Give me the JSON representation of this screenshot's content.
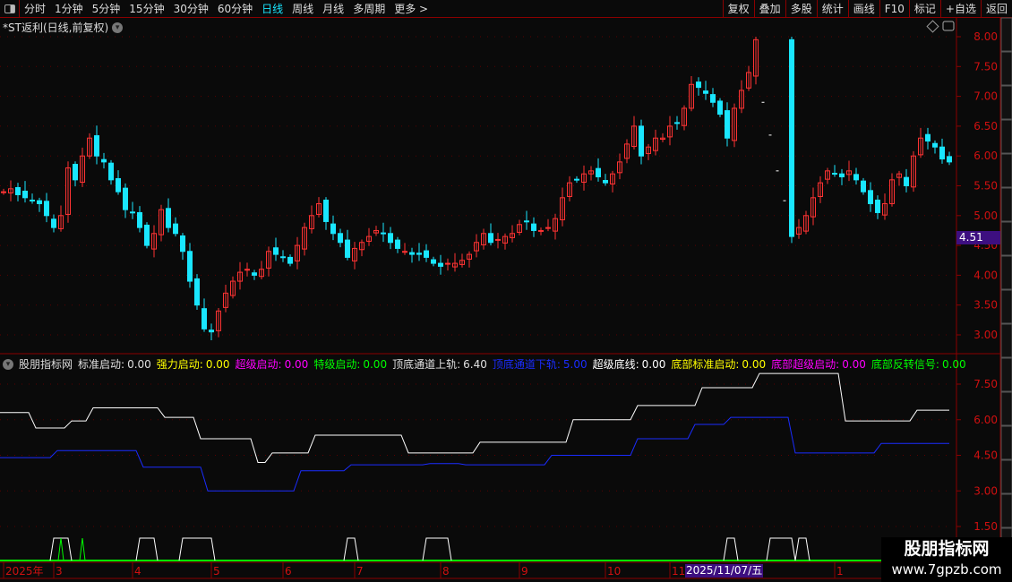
{
  "toolbar": {
    "periods": [
      {
        "label": "分时"
      },
      {
        "label": "1分钟"
      },
      {
        "label": "5分钟"
      },
      {
        "label": "15分钟"
      },
      {
        "label": "30分钟"
      },
      {
        "label": "60分钟"
      },
      {
        "label": "日线",
        "active": true
      },
      {
        "label": "周线"
      },
      {
        "label": "月线"
      },
      {
        "label": "多周期"
      },
      {
        "label": "更多 >"
      }
    ],
    "right_buttons": [
      "复权",
      "叠加",
      "多股",
      "统计",
      "画线",
      "F10",
      "标记",
      "+自选",
      "返回"
    ]
  },
  "chart_title": "*ST返利(日线,前复权)",
  "colors": {
    "up": "#ff3333",
    "down": "#19e6ff",
    "axis": "#8b0000",
    "axis_text": "#d01010",
    "upper_rail": "#ffffff",
    "lower_rail": "#1a2cff",
    "signal": "#00ff00",
    "highlight": "#3d0f80"
  },
  "price_axis": {
    "ticks": [
      "8.00",
      "7.50",
      "7.00",
      "6.50",
      "6.00",
      "5.50",
      "5.00",
      "4.50",
      "4.00",
      "3.50",
      "3.00"
    ],
    "range": [
      3.0,
      8.0
    ],
    "current_price": "4.51"
  },
  "indicator": {
    "name": "股朋指标网",
    "items": [
      {
        "label": "标准启动:",
        "value": "0.00",
        "color": "#e0e0e0"
      },
      {
        "label": "强力启动:",
        "value": "0.00",
        "color": "#ffff00"
      },
      {
        "label": "超级启动:",
        "value": "0.00",
        "color": "#ff00ff"
      },
      {
        "label": "特级启动:",
        "value": "0.00",
        "color": "#00ff00"
      },
      {
        "label": "顶底通道上轨:",
        "value": "6.40",
        "color": "#e0e0e0"
      },
      {
        "label": "顶底通道下轨:",
        "value": "5.00",
        "color": "#1a2cff"
      },
      {
        "label": "超级底线:",
        "value": "0.00",
        "color": "#ffffff"
      },
      {
        "label": "底部标准启动:",
        "value": "0.00",
        "color": "#ffff00"
      },
      {
        "label": "底部超级启动:",
        "value": "0.00",
        "color": "#ff00ff"
      },
      {
        "label": "底部反转信号:",
        "value": "0.00",
        "color": "#00ff00"
      }
    ],
    "axis_ticks": [
      "7.50",
      "6.00",
      "4.50",
      "3.00",
      "1.50"
    ],
    "range": [
      0.9,
      8.3
    ]
  },
  "chart_data": {
    "type": "candlestick",
    "closes": [
      5.4,
      5.45,
      5.35,
      5.3,
      5.25,
      5.2,
      5.0,
      4.8,
      5.0,
      5.8,
      5.6,
      6.0,
      6.3,
      6.0,
      5.9,
      5.6,
      5.4,
      5.1,
      5.05,
      4.8,
      4.5,
      4.7,
      5.1,
      4.8,
      4.7,
      4.4,
      3.9,
      3.5,
      3.1,
      3.05,
      3.4,
      3.7,
      3.9,
      4.05,
      4.1,
      4.0,
      4.1,
      4.4,
      4.35,
      4.3,
      4.2,
      4.5,
      4.8,
      5.0,
      5.2,
      4.9,
      4.7,
      4.55,
      4.3,
      4.45,
      4.55,
      4.65,
      4.75,
      4.7,
      4.55,
      4.45,
      4.4,
      4.35,
      4.35,
      4.3,
      4.2,
      4.15,
      4.2,
      4.2,
      4.25,
      4.35,
      4.55,
      4.7,
      4.55,
      4.6,
      4.65,
      4.7,
      4.85,
      4.9,
      4.75,
      4.75,
      4.8,
      4.95,
      5.3,
      5.55,
      5.6,
      5.7,
      5.75,
      5.65,
      5.55,
      5.7,
      5.9,
      6.2,
      6.5,
      6.0,
      6.15,
      6.3,
      6.3,
      6.5,
      6.55,
      6.8,
      7.2,
      7.15,
      7.05,
      6.9,
      6.7,
      6.3,
      6.8,
      7.1,
      7.4,
      7.95,
      null,
      null,
      null,
      null,
      4.65,
      4.8,
      5.0,
      5.3,
      5.55,
      5.75,
      5.7,
      5.65,
      5.75,
      5.6,
      5.4,
      5.2,
      5.05,
      5.2,
      5.6,
      5.7,
      5.5,
      6.0,
      6.3,
      6.25,
      6.15,
      5.95,
      5.9
    ],
    "suspended_marks": [
      [
        106,
        6.9
      ],
      [
        107,
        6.35
      ],
      [
        108,
        5.75
      ],
      [
        109,
        5.25
      ]
    ],
    "upper_rail_steps": [
      [
        0,
        6.3
      ],
      [
        4,
        5.65
      ],
      [
        9,
        5.95
      ],
      [
        12,
        6.5
      ],
      [
        22,
        6.1
      ],
      [
        27,
        5.2
      ],
      [
        35,
        4.2
      ],
      [
        37,
        4.6
      ],
      [
        43,
        5.35
      ],
      [
        56,
        4.6
      ],
      [
        66,
        5.05
      ],
      [
        79,
        6.0
      ],
      [
        88,
        6.6
      ],
      [
        97,
        7.35
      ],
      [
        105,
        7.95
      ],
      [
        117,
        5.95
      ],
      [
        127,
        6.4
      ]
    ],
    "lower_rail_steps": [
      [
        0,
        4.4
      ],
      [
        7,
        4.7
      ],
      [
        19,
        4.0
      ],
      [
        28,
        3.0
      ],
      [
        41,
        3.85
      ],
      [
        48,
        4.1
      ],
      [
        59,
        4.15
      ],
      [
        64,
        4.1
      ],
      [
        76,
        4.5
      ],
      [
        88,
        5.2
      ],
      [
        96,
        5.8
      ],
      [
        101,
        6.1
      ],
      [
        110,
        4.6
      ],
      [
        122,
        5.0
      ]
    ],
    "white_signals": [
      [
        7,
        9
      ],
      [
        19,
        21
      ],
      [
        25,
        29
      ],
      [
        48,
        49
      ],
      [
        59,
        62
      ],
      [
        101,
        102
      ],
      [
        107,
        110
      ],
      [
        111,
        112
      ]
    ],
    "green_signals": [
      [
        8,
        8
      ],
      [
        11,
        11
      ]
    ]
  },
  "date_axis": {
    "labels": [
      {
        "i": 0,
        "t": "2025年"
      },
      {
        "i": 7,
        "t": "3"
      },
      {
        "i": 18,
        "t": "4"
      },
      {
        "i": 29,
        "t": "5"
      },
      {
        "i": 39,
        "t": "6"
      },
      {
        "i": 49,
        "t": "7"
      },
      {
        "i": 61,
        "t": "8"
      },
      {
        "i": 72,
        "t": "9"
      },
      {
        "i": 84,
        "t": "10"
      },
      {
        "i": 93,
        "t": "11"
      },
      {
        "i": 104,
        "t": "12"
      },
      {
        "i": 116,
        "t": "1"
      }
    ],
    "cursor_date": "2025/11/07/五"
  },
  "watermark": {
    "name": "股朋指标网",
    "url": "www.7gpzb.com"
  }
}
